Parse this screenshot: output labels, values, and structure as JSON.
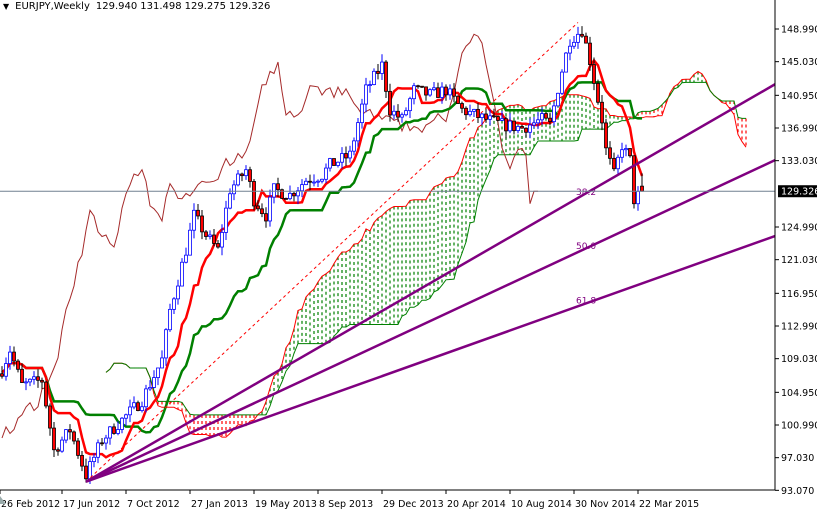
{
  "header": {
    "symbol": "EURJPY,Weekly",
    "open": "129.940",
    "high": "131.498",
    "low": "129.275",
    "close": "129.326"
  },
  "colors": {
    "background": "#ffffff",
    "bull_candle": "#0000ff",
    "bear_candle": "#ff0000",
    "tenkan": "#ff0000",
    "kijun": "#008000",
    "chikou": "#a52a2a",
    "cloud_up": "#008000",
    "cloud_down": "#ff0000",
    "fan": "#800080",
    "bid_line": "#708090"
  },
  "chart_data": {
    "type": "candlestick",
    "title": "EURJPY,Weekly",
    "indicators": [
      "Ichimoku (9,26,52)",
      "Fibonacci fan"
    ],
    "ylim": [
      93.07,
      151.5
    ],
    "y_ticks": [
      "148.990",
      "145.030",
      "140.950",
      "136.990",
      "133.030",
      "124.990",
      "121.030",
      "116.950",
      "112.990",
      "109.030",
      "104.950",
      "100.990",
      "97.030",
      "93.070"
    ],
    "y_tick_values": [
      148.99,
      145.03,
      140.95,
      136.99,
      133.03,
      124.99,
      121.03,
      116.95,
      112.99,
      109.03,
      104.95,
      100.99,
      97.03,
      93.07
    ],
    "current_price": "129.326",
    "current_price_value": 129.326,
    "x_labels": [
      "26 Feb 2012",
      "17 Jun 2012",
      "7 Oct 2012",
      "27 Jan 2013",
      "19 May 2013",
      "8 Sep 2013",
      "29 Dec 2013",
      "20 Apr 2014",
      "10 Aug 2014",
      "30 Nov 2014",
      "22 Mar 2015"
    ],
    "x_label_weeks": [
      0,
      16,
      32,
      48,
      64,
      80,
      96,
      112,
      128,
      144,
      160
    ],
    "close_path_weeks_prices": [
      [
        0,
        107.7
      ],
      [
        2,
        110.1
      ],
      [
        5,
        105.8
      ],
      [
        10,
        106.4
      ],
      [
        13,
        97.9
      ],
      [
        17,
        100.4
      ],
      [
        21,
        94.9
      ],
      [
        25,
        99.2
      ],
      [
        30,
        101.6
      ],
      [
        35,
        104.0
      ],
      [
        40,
        108.9
      ],
      [
        42,
        114.9
      ],
      [
        46,
        122.2
      ],
      [
        48,
        126.4
      ],
      [
        51,
        124.0
      ],
      [
        54,
        122.2
      ],
      [
        57,
        129.5
      ],
      [
        61,
        131.9
      ],
      [
        63,
        128.3
      ],
      [
        66,
        126.4
      ],
      [
        68,
        129.5
      ],
      [
        72,
        128.9
      ],
      [
        76,
        130.7
      ],
      [
        80,
        131.3
      ],
      [
        82,
        132.5
      ],
      [
        87,
        133.7
      ],
      [
        91,
        141.6
      ],
      [
        95,
        144.6
      ],
      [
        97,
        139.2
      ],
      [
        100,
        138.0
      ],
      [
        103,
        141.6
      ],
      [
        107,
        141.0
      ],
      [
        111,
        141.6
      ],
      [
        115,
        139.2
      ],
      [
        120,
        138.2
      ],
      [
        125,
        137.4
      ],
      [
        130,
        137.0
      ],
      [
        135,
        138.0
      ],
      [
        137,
        137.4
      ],
      [
        140,
        144.0
      ],
      [
        142,
        147.7
      ],
      [
        145,
        148.9
      ],
      [
        147,
        145.2
      ],
      [
        150,
        138.0
      ],
      [
        151,
        134.3
      ],
      [
        153,
        131.3
      ],
      [
        155,
        134.9
      ],
      [
        157,
        133.1
      ],
      [
        158,
        128.3
      ],
      [
        160,
        129.326
      ]
    ],
    "last_candle": {
      "open": 129.94,
      "high": 131.498,
      "low": 129.275,
      "close": 129.326
    },
    "fan": {
      "anchor_low": {
        "week": 21,
        "price": 94.12
      },
      "anchor_high": {
        "week": 144,
        "price": 149.78
      },
      "levels": [
        "38.2",
        "50.0",
        "61.8"
      ],
      "level_values": [
        38.2,
        50.0,
        61.8
      ]
    }
  }
}
